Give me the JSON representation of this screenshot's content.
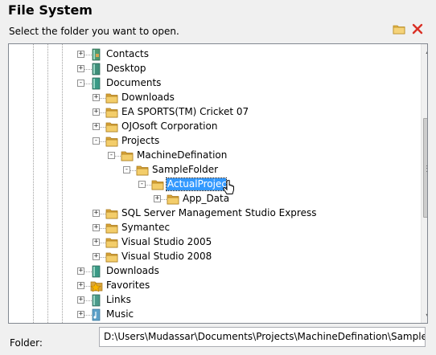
{
  "dialog": {
    "title": "File System",
    "subtitle": "Select the folder you want to open."
  },
  "toolbar": {
    "new_folder_icon": "folder-icon",
    "close_icon": "close-icon"
  },
  "tree": {
    "items": [
      {
        "label": "Contacts",
        "icon": "contacts-icon",
        "expander": "+"
      },
      {
        "label": "Desktop",
        "icon": "desktop-icon",
        "expander": "+"
      },
      {
        "label": "Documents",
        "icon": "documents-icon",
        "expander": "-"
      },
      {
        "label": "Downloads",
        "icon": "folder-icon",
        "expander": "+"
      },
      {
        "label": "EA SPORTS(TM) Cricket 07",
        "icon": "folder-icon",
        "expander": "+"
      },
      {
        "label": "OJOsoft Corporation",
        "icon": "folder-icon",
        "expander": "+"
      },
      {
        "label": "Projects",
        "icon": "folder-icon",
        "expander": "-"
      },
      {
        "label": "MachineDefination",
        "icon": "folder-icon",
        "expander": "-"
      },
      {
        "label": "SampleFolder",
        "icon": "folder-icon",
        "expander": "-"
      },
      {
        "label": "ActualProject",
        "icon": "folder-icon",
        "expander": "-",
        "selected": true
      },
      {
        "label": "App_Data",
        "icon": "folder-icon",
        "expander": "+"
      },
      {
        "label": "SQL Server Management Studio Express",
        "icon": "folder-icon",
        "expander": "+"
      },
      {
        "label": "Symantec",
        "icon": "folder-icon",
        "expander": "+"
      },
      {
        "label": "Visual Studio 2005",
        "icon": "folder-icon",
        "expander": "+"
      },
      {
        "label": "Visual Studio 2008",
        "icon": "folder-icon",
        "expander": "+"
      },
      {
        "label": "Downloads",
        "icon": "downloads-icon",
        "expander": "+"
      },
      {
        "label": "Favorites",
        "icon": "favorites-icon",
        "expander": "+"
      },
      {
        "label": "Links",
        "icon": "links-icon",
        "expander": "+"
      },
      {
        "label": "Music",
        "icon": "music-icon",
        "expander": "+"
      }
    ]
  },
  "scrollbar": {
    "position_fraction": 0.3
  },
  "footer": {
    "folder_label": "Folder:",
    "folder_value": "D:\\Users\\Mudassar\\Documents\\Projects\\MachineDefination\\SampleFolder\\"
  },
  "colors": {
    "selection": "#3399ff",
    "folder_yellow": "#e8b84a",
    "close_red": "#d93025"
  }
}
